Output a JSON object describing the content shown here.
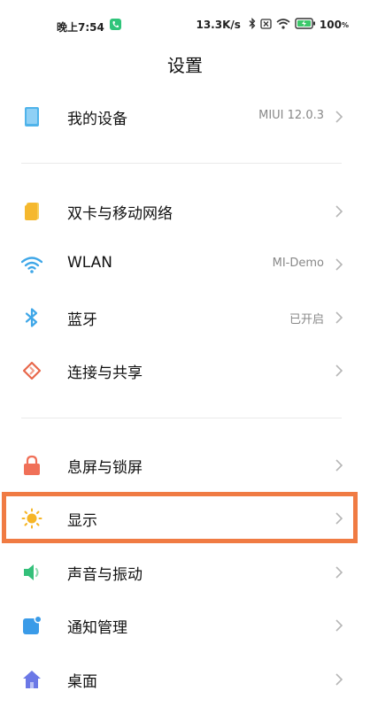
{
  "status_bar": {
    "time": "晚上7:54",
    "speed": "13.3K/s",
    "battery": "100"
  },
  "header": {
    "title": "设置"
  },
  "sections": [
    {
      "items": [
        {
          "label": "我的设备",
          "value": "MIUI 12.0.3",
          "icon": "device-icon"
        }
      ]
    },
    {
      "items": [
        {
          "label": "双卡与移动网络",
          "value": "",
          "icon": "sim-card-icon"
        },
        {
          "label": "WLAN",
          "value": "MI-Demo",
          "icon": "wifi-icon"
        },
        {
          "label": "蓝牙",
          "value": "已开启",
          "icon": "bluetooth-icon"
        },
        {
          "label": "连接与共享",
          "value": "",
          "icon": "share-icon"
        }
      ]
    },
    {
      "items": [
        {
          "label": "息屏与锁屏",
          "value": "",
          "icon": "lock-icon"
        },
        {
          "label": "显示",
          "value": "",
          "icon": "sun-icon"
        },
        {
          "label": "声音与振动",
          "value": "",
          "icon": "speaker-icon"
        },
        {
          "label": "通知管理",
          "value": "",
          "icon": "notification-icon"
        },
        {
          "label": "桌面",
          "value": "",
          "icon": "home-icon"
        }
      ]
    }
  ],
  "colors": {
    "highlight": "#f07b43",
    "device": "#4fb3ea",
    "sim": "#f5b82e",
    "wifi": "#3fa7e8",
    "bluetooth": "#3fa7e8",
    "share": "#e8674a",
    "lock": "#f07058",
    "sun": "#f6b526",
    "speaker": "#34c07a",
    "notification": "#3a9be8",
    "home": "#6b78e6"
  }
}
